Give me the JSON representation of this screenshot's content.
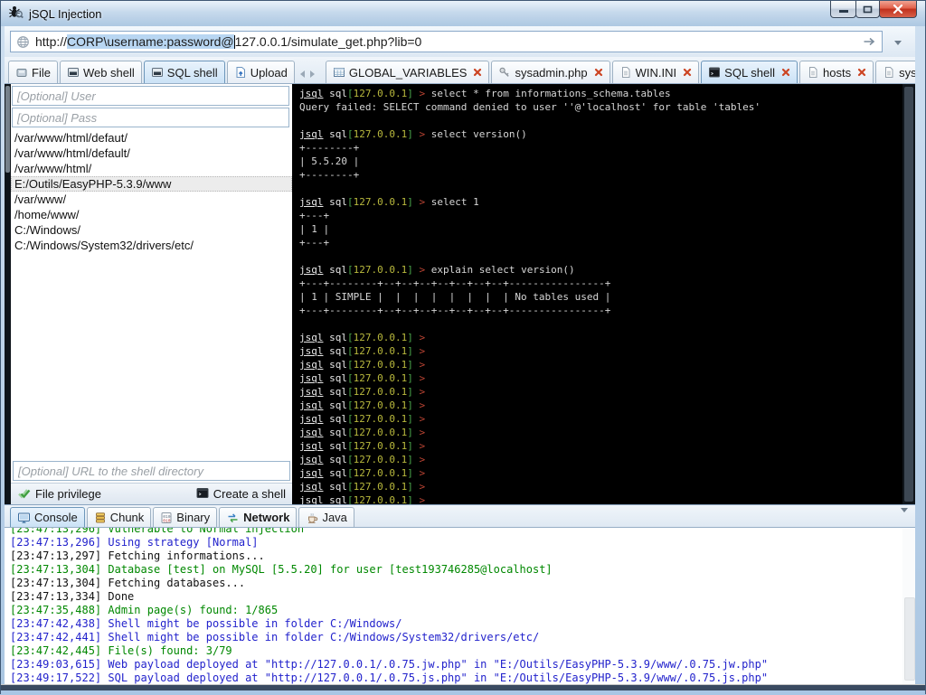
{
  "window": {
    "title": "jSQL Injection"
  },
  "colors": {
    "selection_highlight": "#b8d6f2",
    "tab_selected_bg": "#cbe2f6",
    "terminal_bg": "#000000",
    "terminal_text": "#d6d6d6",
    "prompt_user": "#e9e9e9",
    "prompt_bracket": "#4aa64a",
    "prompt_host": "#b9b93d",
    "prompt_symbol": "#bb4433",
    "log_green": "#008800",
    "log_blue": "#2222cc",
    "log_black": "#111111",
    "close_x": "#cc4422"
  },
  "address_bar": {
    "url_prefix": "http://",
    "url_selected": "CORP\\username:password@",
    "url_suffix": "127.0.0.1/simulate_get.php?lib=0"
  },
  "left_pane": {
    "tabs": [
      {
        "label": "File",
        "icon": "file-icon",
        "selected": false
      },
      {
        "label": "Web shell",
        "icon": "console-icon",
        "selected": false
      },
      {
        "label": "SQL shell",
        "icon": "console-icon",
        "selected": true
      },
      {
        "label": "Upload",
        "icon": "upload-icon",
        "selected": false
      }
    ],
    "user_placeholder": "[Optional] User",
    "pass_placeholder": "[Optional] Pass",
    "paths": [
      {
        "path": "/var/www/html/defaut/",
        "selected": false
      },
      {
        "path": "/var/www/html/default/",
        "selected": false
      },
      {
        "path": "/var/www/html/",
        "selected": false
      },
      {
        "path": "E:/Outils/EasyPHP-5.3.9/www",
        "selected": true
      },
      {
        "path": "/var/www/",
        "selected": false
      },
      {
        "path": "/home/www/",
        "selected": false
      },
      {
        "path": "C:/Windows/",
        "selected": false
      },
      {
        "path": "C:/Windows/System32/drivers/etc/",
        "selected": false
      }
    ],
    "shell_url_placeholder": "[Optional] URL to the shell directory",
    "file_privilege_label": "File privilege",
    "create_shell_label": "Create a shell"
  },
  "document_tabs": [
    {
      "label": "GLOBAL_VARIABLES",
      "icon": "table-icon",
      "selected": false,
      "closable": true
    },
    {
      "label": "sysadmin.php",
      "icon": "key-icon",
      "selected": false,
      "closable": true
    },
    {
      "label": "WIN.INI",
      "icon": "document-icon",
      "selected": false,
      "closable": true
    },
    {
      "label": "SQL shell",
      "icon": "terminal-icon",
      "selected": true,
      "closable": true
    },
    {
      "label": "hosts",
      "icon": "document-icon",
      "selected": false,
      "closable": true
    },
    {
      "label": "system.ini",
      "icon": "document-icon",
      "selected": false,
      "closable": true
    }
  ],
  "terminal": {
    "prompt_user": "jsql",
    "prompt_label": "sql",
    "prompt_host": "127.0.0.1",
    "prompt_symbol": ">",
    "lines": [
      {
        "type": "cmd",
        "text": "select * from informations_schema.tables"
      },
      {
        "type": "out",
        "text": "Query failed: SELECT command denied to user ''@'localhost' for table 'tables'"
      },
      {
        "type": "out",
        "text": ""
      },
      {
        "type": "cmd",
        "text": "select version()"
      },
      {
        "type": "out",
        "text": "+--------+"
      },
      {
        "type": "out",
        "text": "| 5.5.20 |"
      },
      {
        "type": "out",
        "text": "+--------+"
      },
      {
        "type": "out",
        "text": ""
      },
      {
        "type": "cmd",
        "text": "select 1"
      },
      {
        "type": "out",
        "text": "+---+"
      },
      {
        "type": "out",
        "text": "| 1 |"
      },
      {
        "type": "out",
        "text": "+---+"
      },
      {
        "type": "out",
        "text": ""
      },
      {
        "type": "cmd",
        "text": "explain select version()"
      },
      {
        "type": "out",
        "text": "+---+--------+--+--+--+--+--+--+--+----------------+"
      },
      {
        "type": "out",
        "text": "| 1 | SIMPLE |  |  |  |  |  |  |  | No tables used |"
      },
      {
        "type": "out",
        "text": "+---+--------+--+--+--+--+--+--+--+----------------+"
      },
      {
        "type": "out",
        "text": ""
      },
      {
        "type": "cmd",
        "text": ""
      },
      {
        "type": "cmd",
        "text": ""
      },
      {
        "type": "cmd",
        "text": ""
      },
      {
        "type": "cmd",
        "text": ""
      },
      {
        "type": "cmd",
        "text": ""
      },
      {
        "type": "cmd",
        "text": ""
      },
      {
        "type": "cmd",
        "text": ""
      },
      {
        "type": "cmd",
        "text": ""
      },
      {
        "type": "cmd",
        "text": ""
      },
      {
        "type": "cmd",
        "text": ""
      },
      {
        "type": "cmd",
        "text": ""
      },
      {
        "type": "cmd",
        "text": ""
      },
      {
        "type": "cmd",
        "text": ""
      }
    ]
  },
  "bottom_pane": {
    "tabs": [
      {
        "label": "Console",
        "icon": "console-monitor-icon",
        "selected": true,
        "bold": false
      },
      {
        "label": "Chunk",
        "icon": "chunk-icon",
        "selected": false,
        "bold": false
      },
      {
        "label": "Binary",
        "icon": "binary-icon",
        "selected": false,
        "bold": false
      },
      {
        "label": "Network",
        "icon": "network-icon",
        "selected": false,
        "bold": true
      },
      {
        "label": "Java",
        "icon": "java-icon",
        "selected": false,
        "bold": false
      }
    ],
    "log": [
      {
        "time": "23:47:13,296",
        "text": "Vulnerable to Normal injection",
        "color": "green"
      },
      {
        "time": "23:47:13,296",
        "text": "Using strategy [Normal]",
        "color": "blue"
      },
      {
        "time": "23:47:13,297",
        "text": "Fetching informations...",
        "color": "black"
      },
      {
        "time": "23:47:13,304",
        "text": "Database [test] on MySQL [5.5.20] for user [test193746285@localhost]",
        "color": "green"
      },
      {
        "time": "23:47:13,304",
        "text": "Fetching databases...",
        "color": "black"
      },
      {
        "time": "23:47:13,334",
        "text": "Done",
        "color": "black"
      },
      {
        "time": "23:47:35,488",
        "text": "Admin page(s) found: 1/865",
        "color": "green"
      },
      {
        "time": "23:47:42,438",
        "text": "Shell might be possible in folder C:/Windows/",
        "color": "blue"
      },
      {
        "time": "23:47:42,441",
        "text": "Shell might be possible in folder C:/Windows/System32/drivers/etc/",
        "color": "blue"
      },
      {
        "time": "23:47:42,445",
        "text": "File(s) found: 3/79",
        "color": "green"
      },
      {
        "time": "23:49:03,615",
        "text": "Web payload deployed at \"http://127.0.0.1/.0.75.jw.php\" in \"E:/Outils/EasyPHP-5.3.9/www/.0.75.jw.php\"",
        "color": "blue"
      },
      {
        "time": "23:49:17,522",
        "text": "SQL payload deployed at \"http://127.0.0.1/.0.75.js.php\" in \"E:/Outils/EasyPHP-5.3.9/www/.0.75.js.php\"",
        "color": "blue"
      }
    ]
  }
}
